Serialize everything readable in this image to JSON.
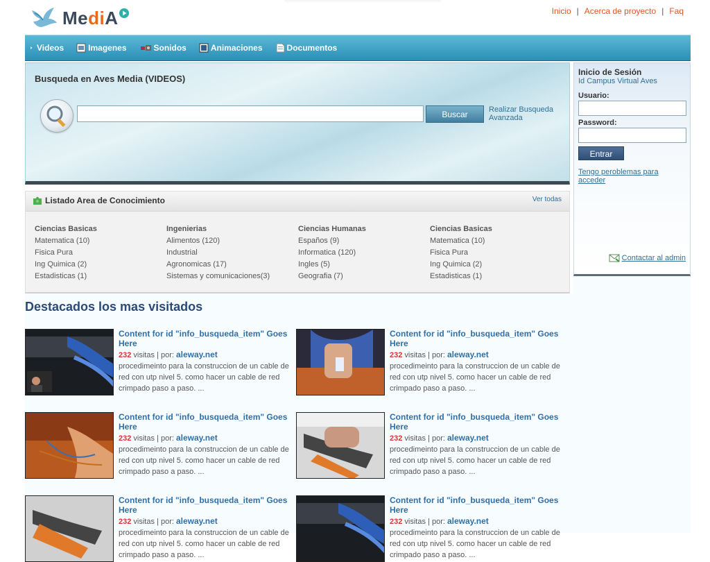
{
  "header": {
    "logo_text_pre": "Me",
    "logo_text_di": "di",
    "logo_text_post": "A",
    "links": [
      "Inicio",
      "Acerca de proyecto",
      "Faq"
    ],
    "separator": "|"
  },
  "nav": {
    "items": [
      {
        "label": "Videos",
        "icon": "play-icon"
      },
      {
        "label": "Imagenes",
        "icon": "image-icon"
      },
      {
        "label": "Sonidos",
        "icon": "speaker-icon"
      },
      {
        "label": "Animaciones",
        "icon": "animation-icon"
      },
      {
        "label": "Documentos",
        "icon": "document-icon"
      }
    ]
  },
  "search": {
    "title": "Busqueda en Aves Media (VIDEOS)",
    "query": "",
    "button": "Buscar",
    "advanced": "Realizar Busqueda Avanzada"
  },
  "area": {
    "title": "Listado Area de Conocimiento",
    "see_all": "Ver todas",
    "columns": [
      {
        "heading": "Ciencias Basicas",
        "items": [
          "Matematica (10)",
          "Fisica Pura",
          "Ing Quimica (2)",
          "Estadisticas (1)"
        ]
      },
      {
        "heading": "Ingenierias",
        "items": [
          "Alimentos (120)",
          "Industrial",
          "Agronomicas (17)",
          "Sistemas y comunicaciones(3)"
        ]
      },
      {
        "heading": "Ciencias Humanas",
        "items": [
          "Españos (9)",
          "Informatica (120)",
          "Ingles (5)",
          "Geografia (7)"
        ]
      },
      {
        "heading": "Ciencias Basicas",
        "items": [
          "Matematica (10)",
          "Fisica Pura",
          "Ing Quimica (2)",
          "Estadisticas (1)"
        ]
      }
    ]
  },
  "login": {
    "title": "Inicio de Sesión",
    "subtitle": "Id Campus Virtual Aves",
    "user_label": "Usuario:",
    "user_value": "",
    "pass_label": "Password:",
    "pass_value": "",
    "button": "Entrar",
    "problem": "Tengo peroblemas para acceder",
    "contact": "Contactar al admin"
  },
  "featured": {
    "title": "Destacados los mas visitados",
    "cards": [
      {
        "title": "Content for id \"info_busqueda_item\" Goes Here",
        "visits": "232",
        "visits_label": "visitas | por:",
        "author": "aleway.net",
        "desc": "procedimeinto para la construccion de un cable de red con utp nivel 5. como hacer un cable de red crimpado paso a paso. ...",
        "thumb": "network-cables"
      },
      {
        "title": "Content for id \"info_busqueda_item\" Goes Here",
        "visits": "232",
        "visits_label": "visitas | por:",
        "author": "aleway.net",
        "desc": "procedimeinto para la construccion de un cable de red con utp nivel 5. como hacer un cable de red crimpado paso a paso. ...",
        "thumb": "cable-roll"
      },
      {
        "title": "Content for id \"info_busqueda_item\" Goes Here",
        "visits": "232",
        "visits_label": "visitas | por:",
        "author": "aleway.net",
        "desc": "procedimeinto para la construccion de un cable de red con utp nivel 5. como hacer un cable de red crimpado paso a paso. ...",
        "thumb": "hands-wires"
      },
      {
        "title": "Content for id \"info_busqueda_item\" Goes Here",
        "visits": "232",
        "visits_label": "visitas | por:",
        "author": "aleway.net",
        "desc": "procedimeinto para la construccion de un cable de red con utp nivel 5. como hacer un cable de red crimpado paso a paso. ...",
        "thumb": "crimping-tool"
      },
      {
        "title": "Content for id \"info_busqueda_item\" Goes Here",
        "visits": "232",
        "visits_label": "visitas | por:",
        "author": "aleway.net",
        "desc": "procedimeinto para la construccion de un cable de red con utp nivel 5. como hacer un cable de red crimpado paso a paso. ...",
        "thumb": "crimping-tool"
      },
      {
        "title": "Content for id \"info_busqueda_item\" Goes Here",
        "visits": "232",
        "visits_label": "visitas | por:",
        "author": "aleway.net",
        "desc": "procedimeinto para la construccion de un cable de red con utp nivel 5. como hacer un cable de red crimpado paso a paso. ...",
        "thumb": "network-cables"
      }
    ]
  },
  "colors": {
    "accent": "#2c8fb7",
    "link": "#e05520",
    "title": "#2a4a78"
  }
}
